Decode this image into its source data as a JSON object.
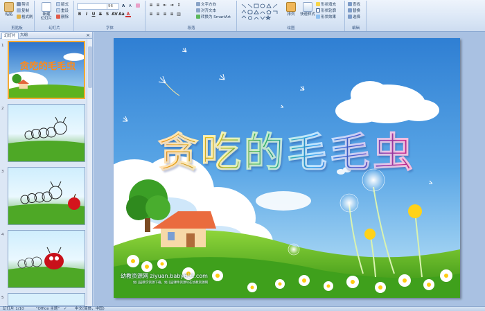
{
  "ribbon": {
    "clipboard": {
      "paste": "粘贴",
      "cut": "剪切",
      "copy": "复制",
      "format_painter": "格式刷",
      "label": "剪贴板"
    },
    "slides": {
      "new_slide": "新建\n幻灯片",
      "layout": "版式",
      "reset": "重设",
      "delete": "删除",
      "label": "幻灯片"
    },
    "font": {
      "font_name": "",
      "font_size": "96",
      "label": "字体"
    },
    "paragraph": {
      "text_direction": "文字方向",
      "align_text": "对齐文本",
      "smartart": "转换为 SmartArt",
      "label": "段落"
    },
    "drawing": {
      "arrange": "排列",
      "quick_styles": "快速样式",
      "shape_fill": "形状填充",
      "shape_outline": "形状轮廓",
      "shape_effects": "形状效果",
      "label": "绘图"
    },
    "editing": {
      "find": "查找",
      "replace": "替换",
      "select": "选择",
      "label": "编辑"
    }
  },
  "panel": {
    "tabs": [
      "幻灯片",
      "大纲"
    ],
    "close": "×",
    "thumbs": [
      {
        "num": "1"
      },
      {
        "num": "2"
      },
      {
        "num": "3"
      },
      {
        "num": "4"
      },
      {
        "num": "5"
      }
    ]
  },
  "slide": {
    "title": "贪吃的毛毛虫",
    "watermark": "幼教资源网 ziyuan.baby611.com",
    "watermark_sub": "幼儿园教学资源下载，幼儿园课件资源尽在幼教资源网"
  },
  "status": {
    "slide_count": "幻灯片 1/10",
    "theme": "\"Office 主题\"",
    "language": "中文(简体，中国)"
  },
  "colors": {
    "accent": "#1e395b",
    "selection": "#f3a933",
    "sky_top": "#2f7fd3"
  }
}
